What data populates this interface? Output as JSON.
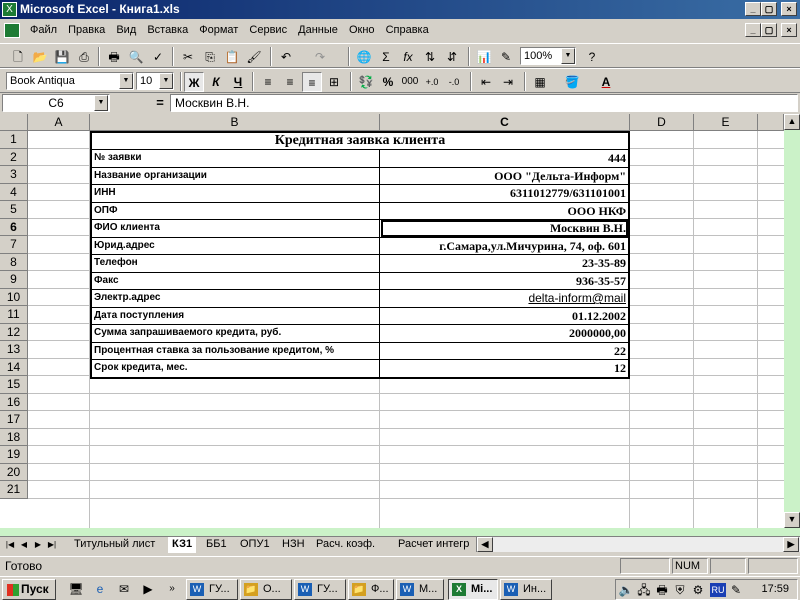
{
  "window": {
    "title": "Microsoft Excel - Книга1.xls"
  },
  "menu": [
    "Файл",
    "Правка",
    "Вид",
    "Вставка",
    "Формат",
    "Сервис",
    "Данные",
    "Окно",
    "Справка"
  ],
  "toolbar": {
    "zoom": "100%",
    "font": "Book Antiqua",
    "size": "10",
    "bold": "Ж",
    "italic": "К",
    "underline": "Ч",
    "comma_style": "000",
    "percent": "%"
  },
  "formula_bar": {
    "name_box": "C6",
    "equals": "=",
    "formula": "Москвин В.Н."
  },
  "columns": [
    "A",
    "B",
    "C",
    "D",
    "E"
  ],
  "rows": [
    "1",
    "2",
    "3",
    "4",
    "5",
    "6",
    "7",
    "8",
    "9",
    "10",
    "11",
    "12",
    "13",
    "14",
    "15",
    "16",
    "17",
    "18",
    "19",
    "20",
    "21"
  ],
  "sheet": {
    "title": "Кредитная заявка клиента",
    "records": [
      {
        "label": "№ заявки",
        "value": "444"
      },
      {
        "label": "Название организации",
        "value": "ООО \"Дельта-Информ\""
      },
      {
        "label": "ИНН",
        "value": "6311012779/631101001"
      },
      {
        "label": "ОПФ",
        "value": "ООО НКФ"
      },
      {
        "label": "ФИО клиента",
        "value": "Москвин В.Н."
      },
      {
        "label": "Юрид.адрес",
        "value": "г.Самара,ул.Мичурина, 74, оф. 601"
      },
      {
        "label": "Телефон",
        "value": "23-35-89"
      },
      {
        "label": "Факс",
        "value": "936-35-57"
      },
      {
        "label": "Электр.адрес",
        "value": "delta-inform@mail"
      },
      {
        "label": "Дата поступления",
        "value": "01.12.2002"
      },
      {
        "label": "Сумма запрашиваемого кредита, руб.",
        "value": "2000000,00"
      },
      {
        "label": "Процентная ставка за пользование кредитом, %",
        "value": "22"
      },
      {
        "label": "Срок кредита, мес.",
        "value": "12"
      }
    ]
  },
  "tabs": [
    "Титульный лист",
    "КЗ1",
    "ББ1",
    "ОПУ1",
    "НЗН",
    "Расч. коэф.",
    "Расчет интегр"
  ],
  "status": {
    "text": "Готово",
    "num": "NUM"
  },
  "taskbar": {
    "start": "Пуск",
    "tasks": [
      "ГУ...",
      "О...",
      "ГУ...",
      "Ф...",
      "М...",
      "Mi...",
      "Ин..."
    ],
    "lang": "RU",
    "clock": "17:59"
  },
  "colors": {
    "titlebar": "#0a246a",
    "accent_green": "#cbf2c8",
    "link": "#000000"
  }
}
